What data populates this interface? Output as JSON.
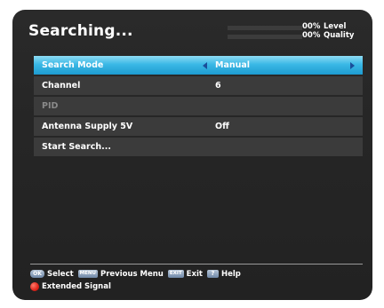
{
  "title": "Searching...",
  "meters": {
    "level": {
      "value": "00%",
      "label": "Level"
    },
    "quality": {
      "value": "00%",
      "label": "Quality"
    }
  },
  "menu": [
    {
      "label": "Search Mode",
      "value": "Manual",
      "selected": true
    },
    {
      "label": "Channel",
      "value": "6"
    },
    {
      "label": "PID",
      "value": "",
      "disabled": true
    },
    {
      "label": "Antenna Supply 5V",
      "value": "Off"
    },
    {
      "label": "Start Search...",
      "value": ""
    }
  ],
  "footer": {
    "select_key": "OK",
    "select": "Select",
    "menu_key": "MENU",
    "previous_menu": "Previous Menu",
    "exit_key": "EXIT",
    "exit": "Exit",
    "help_key": "?",
    "help": "Help",
    "extended_signal": "Extended Signal"
  },
  "colors": {
    "selected_row": "#3ab8e6",
    "row_bg": "#3b3b3b",
    "screen_bg": "#262626",
    "red_button": "#e0241a"
  }
}
